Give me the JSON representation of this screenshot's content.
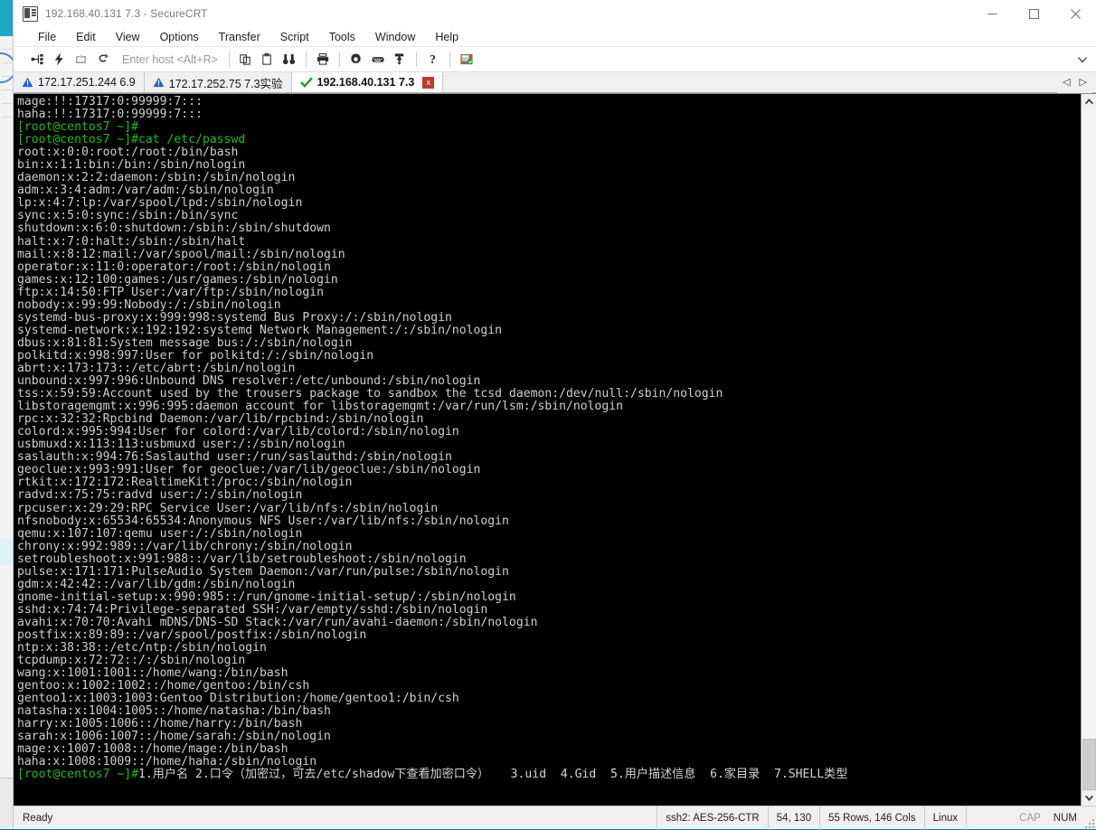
{
  "window": {
    "title": "192.168.40.131 7.3 - SecureCRT",
    "app_icon": "securecrt-icon",
    "minimize_label": "—",
    "maximize_label": "□",
    "close_label": "✕"
  },
  "menubar": {
    "items": [
      {
        "label": "File"
      },
      {
        "label": "Edit"
      },
      {
        "label": "View"
      },
      {
        "label": "Options"
      },
      {
        "label": "Transfer"
      },
      {
        "label": "Script"
      },
      {
        "label": "Tools"
      },
      {
        "label": "Window"
      },
      {
        "label": "Help"
      }
    ]
  },
  "toolbar": {
    "host_entry_placeholder": "Enter host <Alt+R>",
    "overflow_label": "▾",
    "buttons": [
      {
        "name": "connect-icon",
        "title": "Connect"
      },
      {
        "name": "quick-connect-icon",
        "title": "Quick Connect"
      },
      {
        "name": "connect-in-tab-icon",
        "title": "Connect in Tab"
      },
      {
        "name": "disconnect-icon",
        "title": "Disconnect"
      },
      {
        "name": "copy-icon",
        "title": "Copy"
      },
      {
        "name": "paste-icon",
        "title": "Paste"
      },
      {
        "name": "find-icon",
        "title": "Find"
      },
      {
        "name": "print-icon",
        "title": "Print"
      },
      {
        "name": "settings-icon",
        "title": "Session Options"
      },
      {
        "name": "keyboard-icon",
        "title": "Keymap Editor"
      },
      {
        "name": "key-icon",
        "title": "Public Key"
      },
      {
        "name": "help-icon",
        "title": "Help"
      },
      {
        "name": "session-manager-icon",
        "title": "Session Manager"
      }
    ]
  },
  "tabs": {
    "items": [
      {
        "label": "172.17.251.244 6.9",
        "status": "warning",
        "active": false,
        "closable": false
      },
      {
        "label": "172.17.252.75 7.3实验",
        "status": "warning",
        "active": false,
        "closable": false
      },
      {
        "label": "192.168.40.131 7.3",
        "status": "connected",
        "active": true,
        "closable": true,
        "close_label": "x"
      }
    ],
    "nav_prev": "◁",
    "nav_next": "▷"
  },
  "terminal": {
    "colors": {
      "background": "#000000",
      "foreground": "#cfcfcf",
      "prompt_green": "#18c018"
    },
    "lines": [
      {
        "text": "mage:!!:17317:0:99999:7:::",
        "style": "normal"
      },
      {
        "text": "haha:!!:17317:0:99999:7:::",
        "style": "normal"
      },
      {
        "text": "[root@centos7 ~]#",
        "style": "prompt"
      },
      {
        "text": "[root@centos7 ~]#cat /etc/passwd",
        "style": "prompt"
      },
      {
        "text": "root:x:0:0:root:/root:/bin/bash",
        "style": "normal"
      },
      {
        "text": "bin:x:1:1:bin:/bin:/sbin/nologin",
        "style": "normal"
      },
      {
        "text": "daemon:x:2:2:daemon:/sbin:/sbin/nologin",
        "style": "normal"
      },
      {
        "text": "adm:x:3:4:adm:/var/adm:/sbin/nologin",
        "style": "normal"
      },
      {
        "text": "lp:x:4:7:lp:/var/spool/lpd:/sbin/nologin",
        "style": "normal"
      },
      {
        "text": "sync:x:5:0:sync:/sbin:/bin/sync",
        "style": "normal"
      },
      {
        "text": "shutdown:x:6:0:shutdown:/sbin:/sbin/shutdown",
        "style": "normal"
      },
      {
        "text": "halt:x:7:0:halt:/sbin:/sbin/halt",
        "style": "normal"
      },
      {
        "text": "mail:x:8:12:mail:/var/spool/mail:/sbin/nologin",
        "style": "normal"
      },
      {
        "text": "operator:x:11:0:operator:/root:/sbin/nologin",
        "style": "normal"
      },
      {
        "text": "games:x:12:100:games:/usr/games:/sbin/nologin",
        "style": "normal"
      },
      {
        "text": "ftp:x:14:50:FTP User:/var/ftp:/sbin/nologin",
        "style": "normal"
      },
      {
        "text": "nobody:x:99:99:Nobody:/:/sbin/nologin",
        "style": "normal"
      },
      {
        "text": "systemd-bus-proxy:x:999:998:systemd Bus Proxy:/:/sbin/nologin",
        "style": "normal"
      },
      {
        "text": "systemd-network:x:192:192:systemd Network Management:/:/sbin/nologin",
        "style": "normal"
      },
      {
        "text": "dbus:x:81:81:System message bus:/:/sbin/nologin",
        "style": "normal"
      },
      {
        "text": "polkitd:x:998:997:User for polkitd:/:/sbin/nologin",
        "style": "normal"
      },
      {
        "text": "abrt:x:173:173::/etc/abrt:/sbin/nologin",
        "style": "normal"
      },
      {
        "text": "unbound:x:997:996:Unbound DNS resolver:/etc/unbound:/sbin/nologin",
        "style": "normal"
      },
      {
        "text": "tss:x:59:59:Account used by the trousers package to sandbox the tcsd daemon:/dev/null:/sbin/nologin",
        "style": "normal"
      },
      {
        "text": "libstoragemgmt:x:996:995:daemon account for libstoragemgmt:/var/run/lsm:/sbin/nologin",
        "style": "normal"
      },
      {
        "text": "rpc:x:32:32:Rpcbind Daemon:/var/lib/rpcbind:/sbin/nologin",
        "style": "normal"
      },
      {
        "text": "colord:x:995:994:User for colord:/var/lib/colord:/sbin/nologin",
        "style": "normal"
      },
      {
        "text": "usbmuxd:x:113:113:usbmuxd user:/:/sbin/nologin",
        "style": "normal"
      },
      {
        "text": "saslauth:x:994:76:Saslauthd user:/run/saslauthd:/sbin/nologin",
        "style": "normal"
      },
      {
        "text": "geoclue:x:993:991:User for geoclue:/var/lib/geoclue:/sbin/nologin",
        "style": "normal"
      },
      {
        "text": "rtkit:x:172:172:RealtimeKit:/proc:/sbin/nologin",
        "style": "normal"
      },
      {
        "text": "radvd:x:75:75:radvd user:/:/sbin/nologin",
        "style": "normal"
      },
      {
        "text": "rpcuser:x:29:29:RPC Service User:/var/lib/nfs:/sbin/nologin",
        "style": "normal"
      },
      {
        "text": "nfsnobody:x:65534:65534:Anonymous NFS User:/var/lib/nfs:/sbin/nologin",
        "style": "normal"
      },
      {
        "text": "qemu:x:107:107:qemu user:/:/sbin/nologin",
        "style": "normal"
      },
      {
        "text": "chrony:x:992:989::/var/lib/chrony:/sbin/nologin",
        "style": "normal"
      },
      {
        "text": "setroubleshoot:x:991:988::/var/lib/setroubleshoot:/sbin/nologin",
        "style": "normal"
      },
      {
        "text": "pulse:x:171:171:PulseAudio System Daemon:/var/run/pulse:/sbin/nologin",
        "style": "normal"
      },
      {
        "text": "gdm:x:42:42::/var/lib/gdm:/sbin/nologin",
        "style": "normal"
      },
      {
        "text": "gnome-initial-setup:x:990:985::/run/gnome-initial-setup/:/sbin/nologin",
        "style": "normal"
      },
      {
        "text": "sshd:x:74:74:Privilege-separated SSH:/var/empty/sshd:/sbin/nologin",
        "style": "normal"
      },
      {
        "text": "avahi:x:70:70:Avahi mDNS/DNS-SD Stack:/var/run/avahi-daemon:/sbin/nologin",
        "style": "normal"
      },
      {
        "text": "postfix:x:89:89::/var/spool/postfix:/sbin/nologin",
        "style": "normal"
      },
      {
        "text": "ntp:x:38:38::/etc/ntp:/sbin/nologin",
        "style": "normal"
      },
      {
        "text": "tcpdump:x:72:72::/:/sbin/nologin",
        "style": "normal"
      },
      {
        "text": "wang:x:1001:1001::/home/wang:/bin/bash",
        "style": "normal"
      },
      {
        "text": "gentoo:x:1002:1002::/home/gentoo:/bin/csh",
        "style": "normal"
      },
      {
        "text": "gentoo1:x:1003:1003:Gentoo Distribution:/home/gentoo1:/bin/csh",
        "style": "normal"
      },
      {
        "text": "natasha:x:1004:1005::/home/natasha:/bin/bash",
        "style": "normal"
      },
      {
        "text": "harry:x:1005:1006::/home/harry:/bin/bash",
        "style": "normal"
      },
      {
        "text": "sarah:x:1006:1007::/home/sarah:/sbin/nologin",
        "style": "normal"
      },
      {
        "text": "mage:x:1007:1008::/home/mage:/bin/bash",
        "style": "normal"
      },
      {
        "text": "haha:x:1008:1009::/home/haha:/sbin/nologin",
        "style": "normal"
      }
    ],
    "last_line": {
      "prompt": "[root@centos7 ~]#",
      "typed": "1.用户名 2.口令（加密过，可去/etc/shadow下查看加密口令）   3.uid  4.Gid  5.用户描述信息  6.家目录  7.SHELL类型"
    },
    "scrollbar": {
      "up_arrow": "⌃",
      "down_arrow": "⌄"
    }
  },
  "statusbar": {
    "ready": "Ready",
    "protocol": "ssh2: AES-256-CTR",
    "cursor_position": "54, 130",
    "dimensions": "55 Rows, 146 Cols",
    "emulation": "Linux",
    "cap_indicator": "CAP",
    "num_indicator": "NUM"
  }
}
